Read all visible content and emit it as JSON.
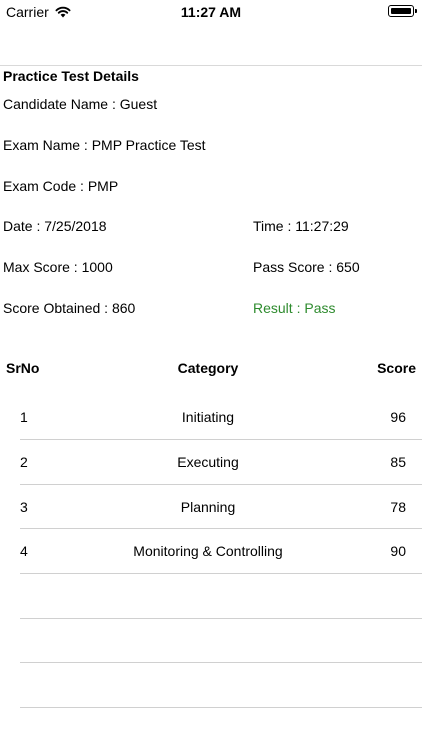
{
  "status_bar": {
    "carrier": "Carrier",
    "time": "11:27 AM"
  },
  "details": {
    "title": "Practice Test Details",
    "candidate": "Candidate Name : Guest",
    "exam_name": "Exam Name : PMP Practice Test",
    "exam_code": "Exam Code : PMP",
    "date": "Date : 7/25/2018",
    "time": "Time : 11:27:29",
    "max_score": "Max Score : 1000",
    "pass_score": "Pass Score : 650",
    "score_obtained": "Score Obtained : 860",
    "result": "Result : Pass"
  },
  "colors": {
    "result_pass": "#2e8b2e"
  },
  "table": {
    "headers": {
      "srno": "SrNo",
      "category": "Category",
      "score": "Score"
    },
    "rows": [
      {
        "srno": "1",
        "category": "Initiating",
        "score": "96"
      },
      {
        "srno": "2",
        "category": "Executing",
        "score": "85"
      },
      {
        "srno": "3",
        "category": "Planning",
        "score": "78"
      },
      {
        "srno": "4",
        "category": "Monitoring & Controlling",
        "score": "90"
      }
    ]
  }
}
